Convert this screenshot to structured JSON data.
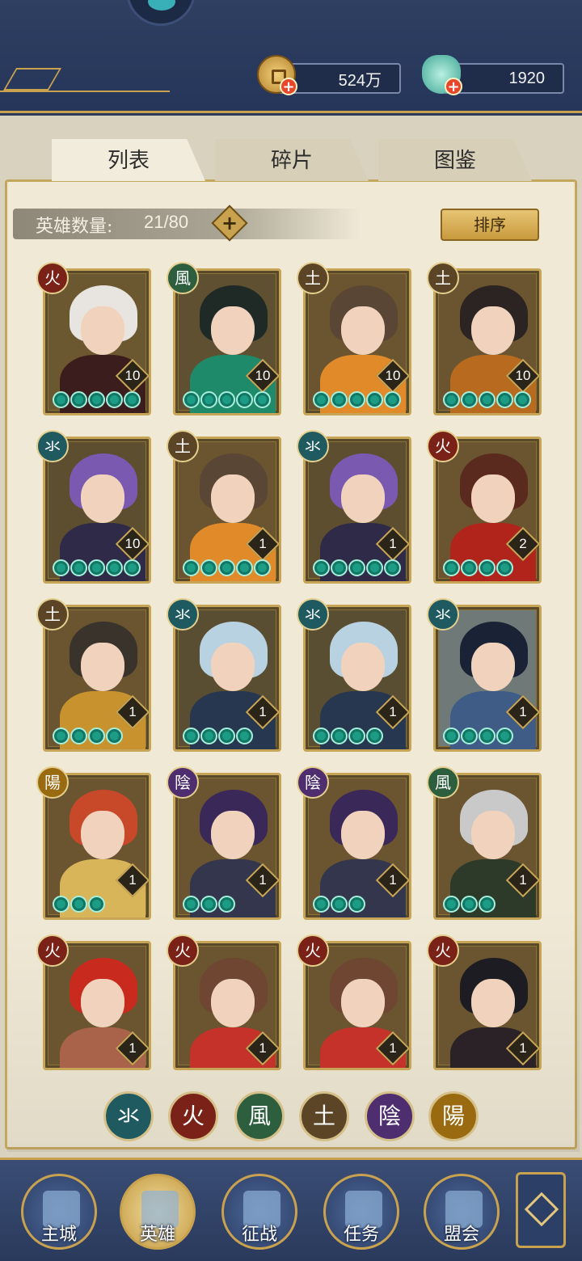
{
  "resources": {
    "coin": "524万",
    "gem": "1920"
  },
  "tabs": [
    "列表",
    "碎片",
    "图鉴"
  ],
  "hero_count": {
    "label": "英雄数量:",
    "value": "21/80"
  },
  "sort_label": "排序",
  "elements": {
    "water": {
      "glyph": "氺",
      "color": "#1f5a60"
    },
    "fire": {
      "glyph": "火",
      "color": "#7a2217"
    },
    "wind": {
      "glyph": "風",
      "color": "#2d5e3e"
    },
    "earth": {
      "glyph": "土",
      "color": "#5b4526"
    },
    "yin": {
      "glyph": "陰",
      "color": "#4e2e6e"
    },
    "yang": {
      "glyph": "陽",
      "color": "#9a6a10"
    }
  },
  "heroes": [
    {
      "element": "火",
      "elem_color": "#7a2217",
      "level": "10",
      "stars": 5,
      "hair": "#e8e4e0",
      "body": "#3c1d1d",
      "bg": "#6b5730"
    },
    {
      "element": "風",
      "elem_color": "#2d5e3e",
      "level": "10",
      "stars": 5,
      "hair": "#1f2a26",
      "body": "#1f8a6a",
      "bg": "#5e5030"
    },
    {
      "element": "土",
      "elem_color": "#5b4526",
      "level": "10",
      "stars": 5,
      "hair": "#5a4634",
      "body": "#e08a2a",
      "bg": "#6a5530"
    },
    {
      "element": "土",
      "elem_color": "#5b4526",
      "level": "10",
      "stars": 5,
      "hair": "#2b2422",
      "body": "#b86a1e",
      "bg": "#6a5530"
    },
    {
      "element": "氺",
      "elem_color": "#1f5a60",
      "level": "10",
      "stars": 5,
      "hair": "#7a5ab0",
      "body": "#2e2a48",
      "bg": "#5d4e30"
    },
    {
      "element": "土",
      "elem_color": "#5b4526",
      "level": "1",
      "stars": 5,
      "hair": "#5a4634",
      "body": "#e08a2a",
      "bg": "#6a5530"
    },
    {
      "element": "氺",
      "elem_color": "#1f5a60",
      "level": "1",
      "stars": 5,
      "hair": "#7a5ab0",
      "body": "#2e2a48",
      "bg": "#5d4e30"
    },
    {
      "element": "火",
      "elem_color": "#7a2217",
      "level": "2",
      "stars": 4,
      "hair": "#5a2a1e",
      "body": "#b0241c",
      "bg": "#6a5530"
    },
    {
      "element": "土",
      "elem_color": "#5b4526",
      "level": "1",
      "stars": 4,
      "hair": "#3a332c",
      "body": "#c8932e",
      "bg": "#6a5530"
    },
    {
      "element": "氺",
      "elem_color": "#1f5a60",
      "level": "1",
      "stars": 4,
      "hair": "#b9d2e2",
      "body": "#26374f",
      "bg": "#5a4e32"
    },
    {
      "element": "氺",
      "elem_color": "#1f5a60",
      "level": "1",
      "stars": 4,
      "hair": "#b9d2e2",
      "body": "#26374f",
      "bg": "#5a4e32"
    },
    {
      "element": "氺",
      "elem_color": "#1f5a60",
      "level": "1",
      "stars": 4,
      "hair": "#1a2236",
      "body": "#3f5c86",
      "bg": "#6f7a78"
    },
    {
      "element": "陽",
      "elem_color": "#9a6a10",
      "level": "1",
      "stars": 3,
      "hair": "#c8482a",
      "body": "#d9b55a",
      "bg": "#6a5530"
    },
    {
      "element": "陰",
      "elem_color": "#4e2e6e",
      "level": "1",
      "stars": 3,
      "hair": "#3a2858",
      "body": "#34364e",
      "bg": "#6a5530"
    },
    {
      "element": "陰",
      "elem_color": "#4e2e6e",
      "level": "1",
      "stars": 3,
      "hair": "#3a2858",
      "body": "#34364e",
      "bg": "#6a5530"
    },
    {
      "element": "風",
      "elem_color": "#2d5e3e",
      "level": "1",
      "stars": 3,
      "hair": "#c9c9c9",
      "body": "#2d3a2a",
      "bg": "#6a5530"
    },
    {
      "element": "火",
      "elem_color": "#7a2217",
      "level": "1",
      "stars": 3,
      "hair": "#c92a1e",
      "body": "#a8634a",
      "bg": "#6a5530"
    },
    {
      "element": "火",
      "elem_color": "#7a2217",
      "level": "1",
      "stars": 3,
      "hair": "#6e4632",
      "body": "#c4322a",
      "bg": "#6a5530"
    },
    {
      "element": "火",
      "elem_color": "#7a2217",
      "level": "1",
      "stars": 3,
      "hair": "#6e4632",
      "body": "#c4322a",
      "bg": "#6a5530"
    },
    {
      "element": "火",
      "elem_color": "#7a2217",
      "level": "1",
      "stars": 3,
      "hair": "#1c1c22",
      "body": "#2a2226",
      "bg": "#6a5530"
    }
  ],
  "filters": [
    "氺",
    "火",
    "風",
    "土",
    "陰",
    "陽"
  ],
  "filter_colors": [
    "#1f5a60",
    "#7a2217",
    "#2d5e3e",
    "#5b4526",
    "#4e2e6e",
    "#9a6a10"
  ],
  "nav": [
    "主城",
    "英雄",
    "征战",
    "任务",
    "盟会"
  ]
}
